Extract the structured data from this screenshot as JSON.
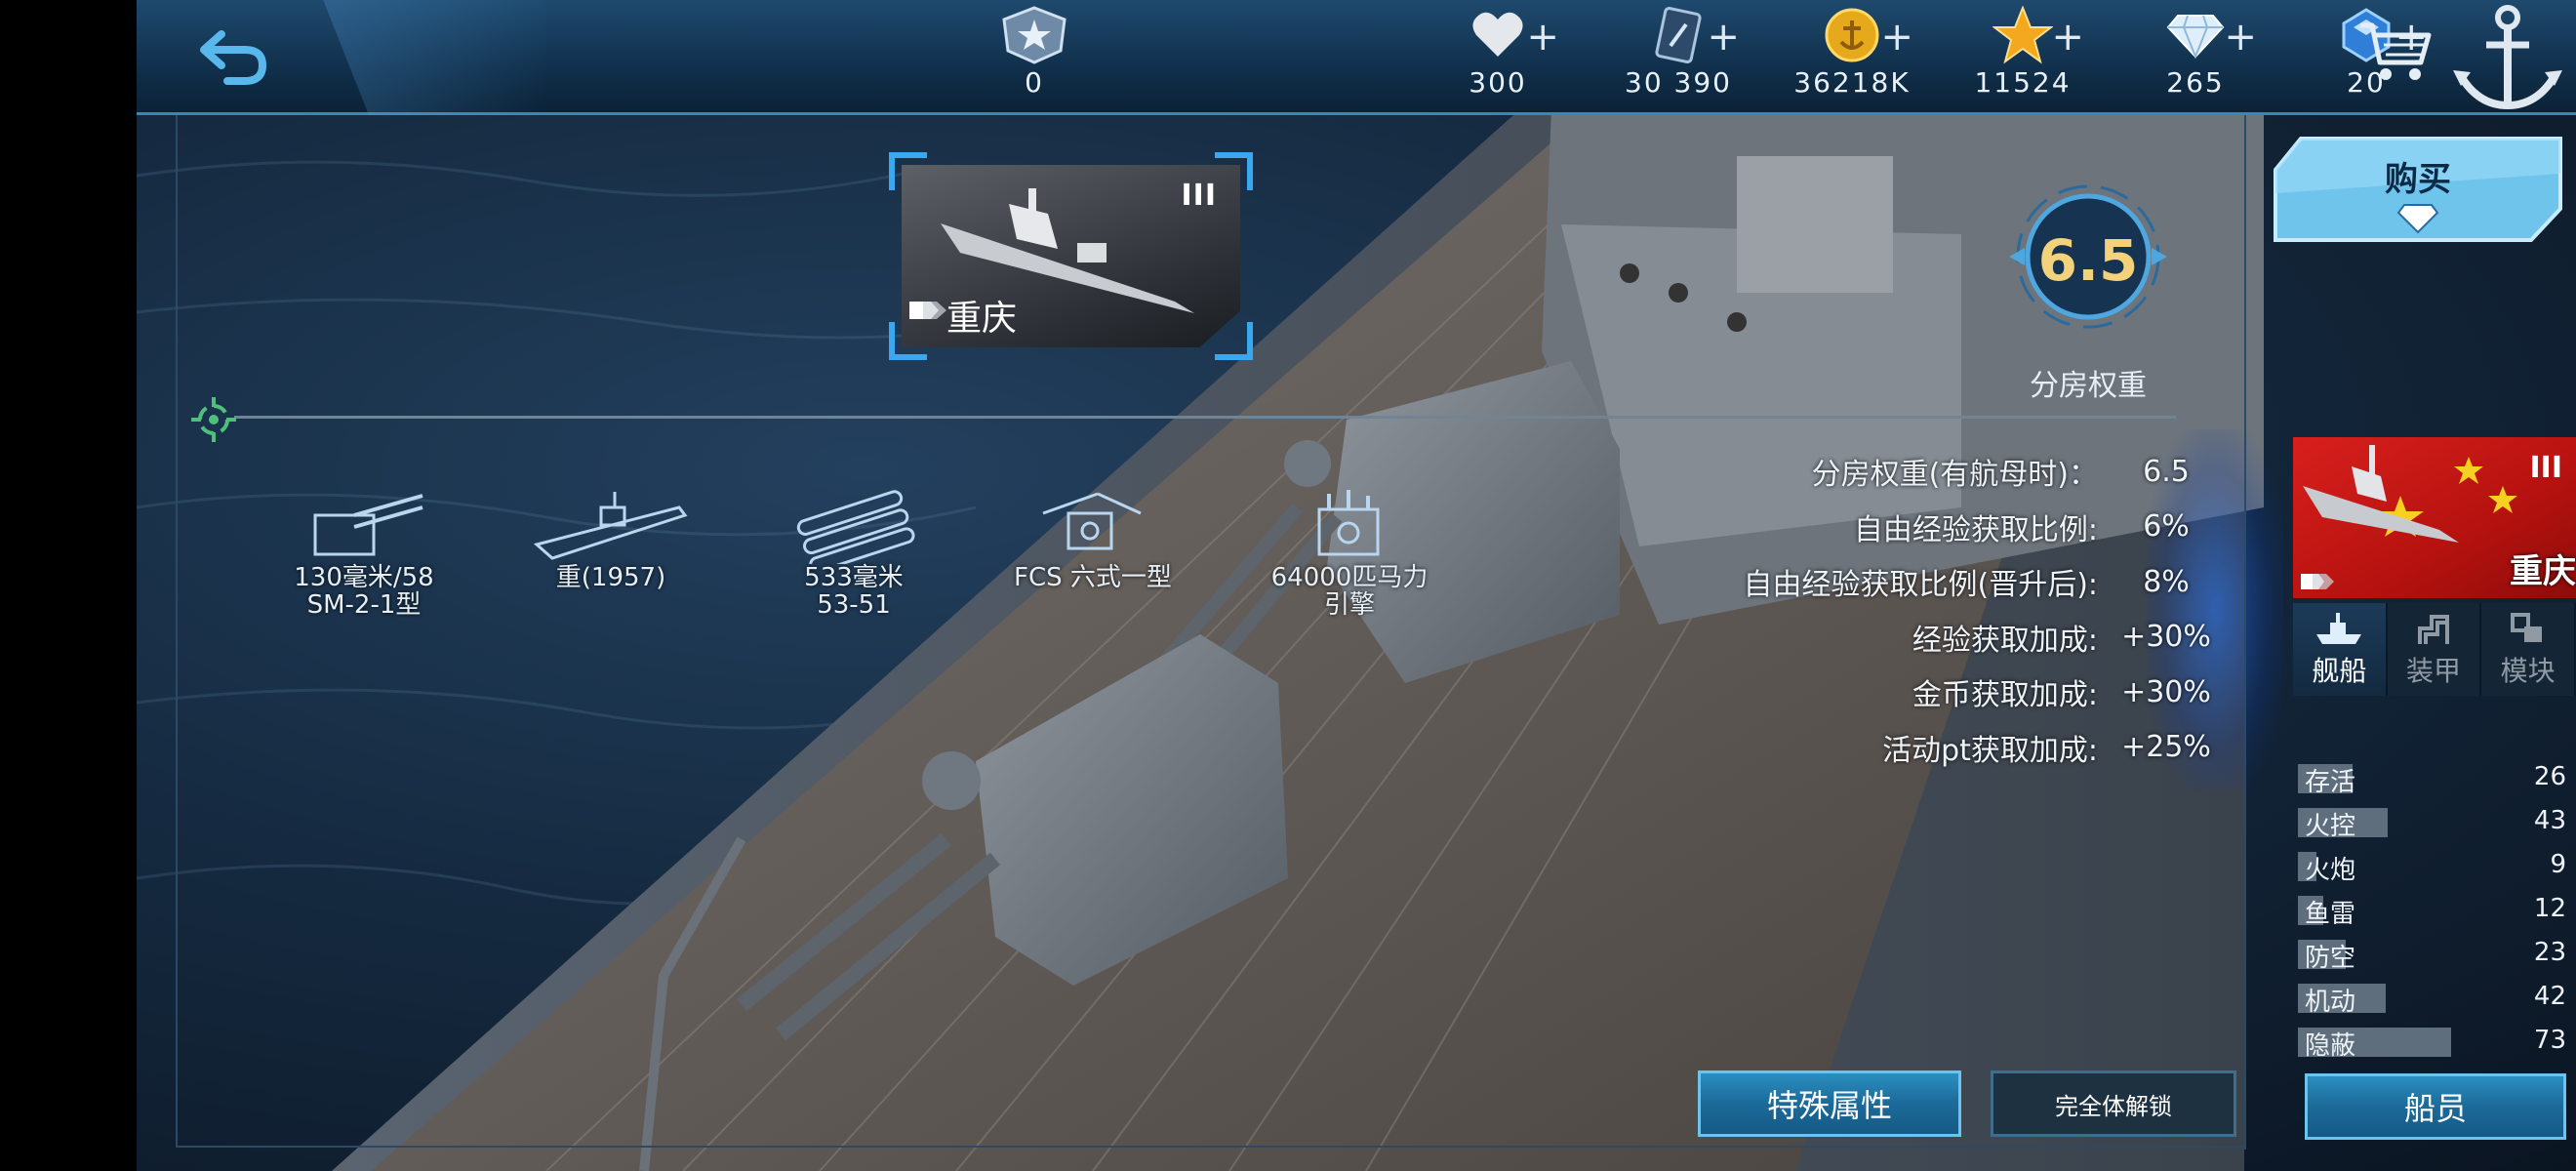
{
  "topbar": {
    "resources": [
      {
        "name": "rank-icon",
        "value": "0",
        "has_plus": false
      },
      {
        "name": "heart-icon",
        "value": "300",
        "has_plus": true
      },
      {
        "name": "card-icon",
        "value": "30 390",
        "has_plus": true
      },
      {
        "name": "gold-coin-icon",
        "value": "36218K",
        "has_plus": true
      },
      {
        "name": "star-icon",
        "value": "11524",
        "has_plus": true
      },
      {
        "name": "diamond-icon",
        "value": "265",
        "has_plus": true
      },
      {
        "name": "blue-gem-icon",
        "value": "20",
        "has_plus": true
      }
    ],
    "plus": "+"
  },
  "ship_card": {
    "name": "重庆",
    "tier": "III"
  },
  "weight": {
    "value": "6.5",
    "label": "分房权重"
  },
  "equipment": [
    {
      "icon": "main-gun-icon",
      "line1": "130毫米/58",
      "line2": "SM-2-1型"
    },
    {
      "icon": "hull-icon",
      "line1": "重(1957)",
      "line2": ""
    },
    {
      "icon": "torpedo-icon",
      "line1": "533毫米",
      "line2": "53-51"
    },
    {
      "icon": "fire-control-icon",
      "line1": "FCS 六式一型",
      "line2": ""
    },
    {
      "icon": "engine-icon",
      "line1": "64000匹马力",
      "line2": "引擎"
    }
  ],
  "stats": [
    {
      "label": "分房权重(有航母时)：",
      "value": "6.5"
    },
    {
      "label": "自由经验获取比例:",
      "value": "6%"
    },
    {
      "label": "自由经验获取比例(晋升后):",
      "value": "8%"
    },
    {
      "label": "经验获取加成:",
      "value": "+30%"
    },
    {
      "label": "金币获取加成:",
      "value": "+30%"
    },
    {
      "label": "活动pt获取加成:",
      "value": "+25%"
    }
  ],
  "buy": {
    "label": "购买"
  },
  "side_card": {
    "name": "重庆",
    "tier": "III"
  },
  "tabs": [
    {
      "label": "舰船",
      "icon": "ship-tab-icon",
      "active": true
    },
    {
      "label": "装甲",
      "icon": "armor-tab-icon",
      "active": false
    },
    {
      "label": "模块",
      "icon": "module-tab-icon",
      "active": false
    }
  ],
  "attributes": [
    {
      "label": "存活",
      "value": "26",
      "level": 0.26
    },
    {
      "label": "火控",
      "value": "43",
      "level": 0.43
    },
    {
      "label": "火炮",
      "value": "9",
      "level": 0.09
    },
    {
      "label": "鱼雷",
      "value": "12",
      "level": 0.12
    },
    {
      "label": "防空",
      "value": "23",
      "level": 0.23
    },
    {
      "label": "机动",
      "value": "42",
      "level": 0.42
    },
    {
      "label": "隐蔽",
      "value": "73",
      "level": 0.73
    }
  ],
  "buttons": {
    "special": "特殊属性",
    "unlock": "完全体解锁",
    "crew": "船员"
  },
  "colors": {
    "accent": "#2a8fc0",
    "gold": "#f4d27c",
    "flag_red": "#d8201d"
  }
}
